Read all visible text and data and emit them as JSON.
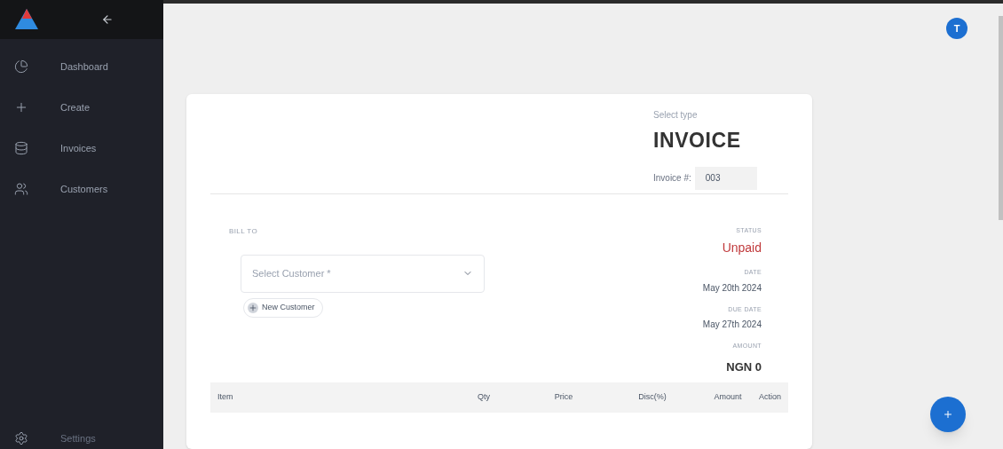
{
  "sidebar": {
    "items": [
      {
        "label": "Dashboard",
        "kind": "dashboard"
      },
      {
        "label": "Create",
        "kind": "create"
      },
      {
        "label": "Invoices",
        "kind": "invoices"
      },
      {
        "label": "Customers",
        "kind": "customers"
      }
    ],
    "footer_item": {
      "label": "Settings",
      "kind": "settings"
    }
  },
  "header": {
    "avatar": "T"
  },
  "invoice": {
    "type_label": "Select type",
    "type": "INVOICE",
    "number_label": "Invoice #:",
    "number": "003",
    "bill_to_label": "BILL TO",
    "customer_placeholder": "Select Customer *",
    "new_customer": "New Customer",
    "status_label": "STATUS",
    "status": "Unpaid",
    "date_label": "DATE",
    "date": "May 20th 2024",
    "due_label": "DUE DATE",
    "due": "May 27th 2024",
    "amount_label": "AMOUNT",
    "amount": "NGN 0"
  },
  "table": {
    "columns": [
      "Item",
      "Qty",
      "Price",
      "Disc(%)",
      "Amount",
      "Action"
    ]
  }
}
